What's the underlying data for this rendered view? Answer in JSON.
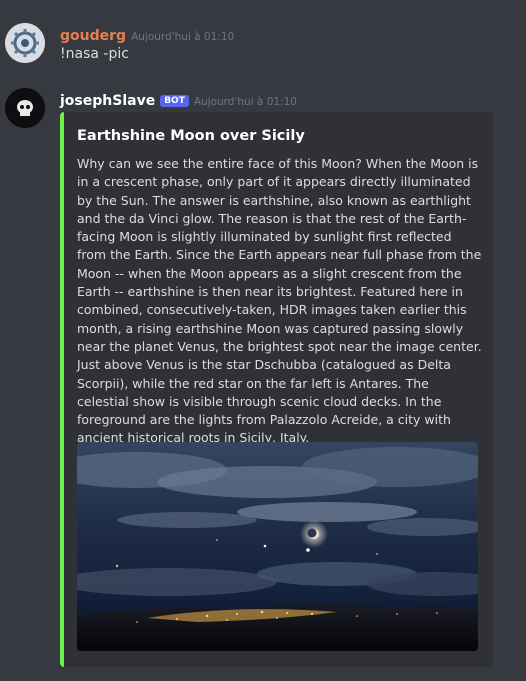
{
  "messages": [
    {
      "username": "gouderg",
      "timestamp": "Aujourd'hui à 01:10",
      "content": "!nasa -pic"
    },
    {
      "username": "josephSlave",
      "badge": "BOT",
      "timestamp": "Aujourd'hui à 01:10",
      "embed": {
        "title": "Earthshine Moon over Sicily",
        "description": "Why can we see the entire face of this Moon? When the Moon is in a crescent phase, only part of it appears directly illuminated by the Sun. The answer is earthshine, also known as earthlight and the da Vinci glow. The reason is that the rest of the Earth-facing Moon is slightly illuminated by sunlight first reflected from the Earth. Since the Earth appears near full phase from the Moon -- when the Moon appears as a slight crescent from the Earth -- earthshine is then near its brightest. Featured here in combined, consecutively-taken, HDR images taken earlier this month, a rising earthshine Moon was captured passing slowly near the planet Venus, the brightest spot near the image center. Just above Venus is the star Dschubba (catalogued as Delta Scorpii), while the red star on the far left is Antares. The celestial show is visible through scenic cloud decks. In the foreground are the lights from Palazzolo Acreide, a city with ancient historical roots in Sicily, Italy.",
        "accent_color": "#6cf04a"
      }
    }
  ]
}
